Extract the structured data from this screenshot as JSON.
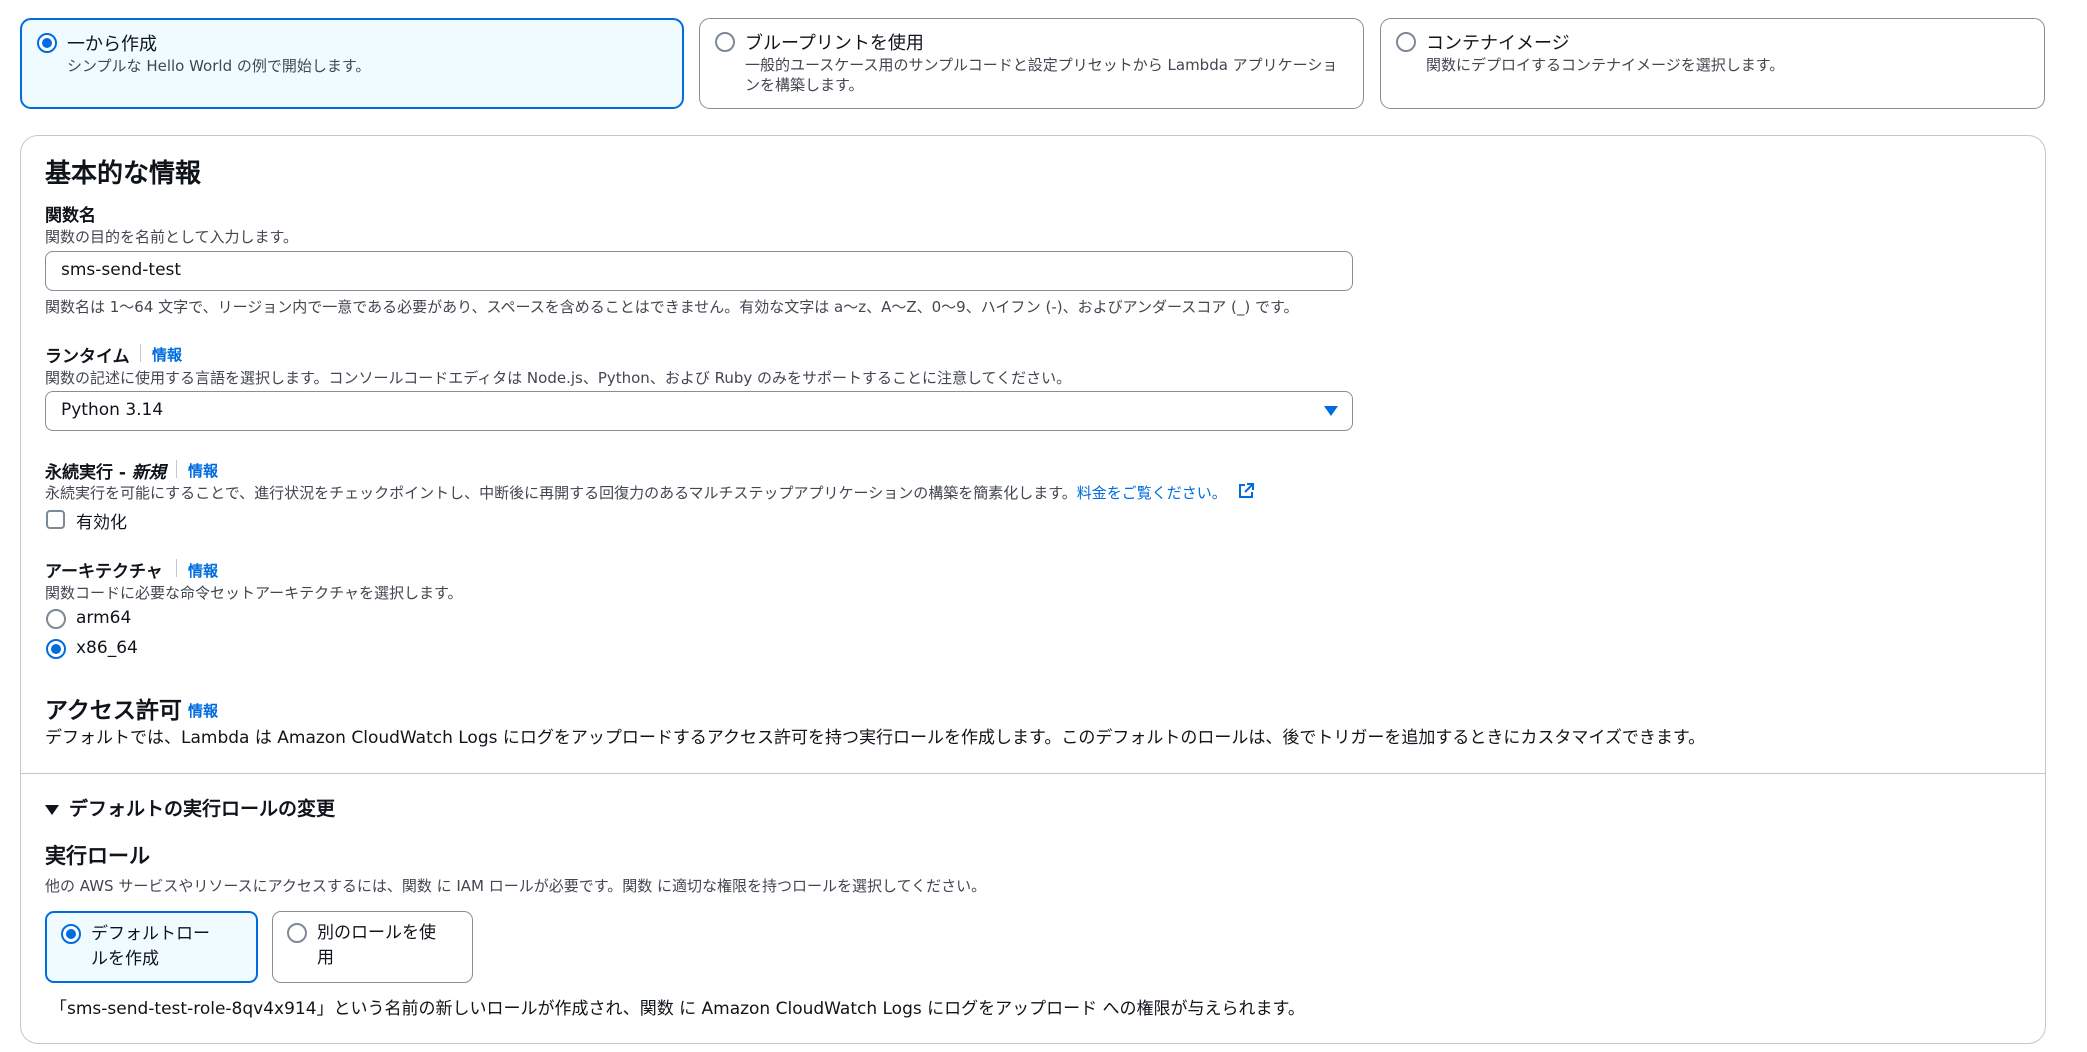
{
  "options": [
    {
      "title": "一から作成",
      "desc": "シンプルな Hello World の例で開始します。",
      "selected": true
    },
    {
      "title": "ブループリントを使用",
      "desc": "一般的ユースケース用のサンプルコードと設定プリセットから Lambda アプリケーションを構築します。",
      "selected": false
    },
    {
      "title": "コンテナイメージ",
      "desc": "関数にデプロイするコンテナイメージを選択します。",
      "selected": false
    }
  ],
  "basic": {
    "heading": "基本的な情報",
    "function_name": {
      "label": "関数名",
      "desc": "関数の目的を名前として入力します。",
      "value": "sms-send-test",
      "constraint": "関数名は 1〜64 文字で、リージョン内で一意である必要があり、スペースを含めることはできません。有効な文字は a〜z、A〜Z、0〜9、ハイフン (-)、およびアンダースコア (_) です。"
    },
    "runtime": {
      "label": "ランタイム",
      "info": "情報",
      "desc": "関数の記述に使用する言語を選択します。コンソールコードエディタは Node.js、Python、および Ruby のみをサポートすることに注意してください。",
      "value": "Python 3.14"
    },
    "durable": {
      "label": "永続実行 - ",
      "label_new": "新規",
      "info": "情報",
      "desc": "永続実行を可能にすることで、進行状況をチェックポイントし、中断後に再開する回復力のあるマルチステップアプリケーションの構築を簡素化します。",
      "link": "料金をご覧ください。",
      "checkbox_label": "有効化",
      "checked": false
    },
    "arch": {
      "label": "アーキテクチャ",
      "info": "情報",
      "desc": "関数コードに必要な命令セットアーキテクチャを選択します。",
      "options": [
        "arm64",
        "x86_64"
      ],
      "selected": "x86_64"
    },
    "access": {
      "heading": "アクセス許可",
      "info": "情報",
      "desc": "デフォルトでは、Lambda は Amazon CloudWatch Logs にログをアップロードするアクセス許可を持つ実行ロールを作成します。このデフォルトのロールは、後でトリガーを追加するときにカスタマイズできます。"
    },
    "role_section": {
      "toggle": "デフォルトの実行ロールの変更",
      "heading": "実行ロール",
      "desc": "他の AWS サービスやリソースにアクセスするには、関数 に IAM ロールが必要です。関数 に適切な権限を持つロールを選択してください。",
      "options": [
        "デフォルトロールを作成",
        "別のロールを使用"
      ],
      "selected": "デフォルトロールを作成",
      "note": "「sms-send-test-role-8qv4x914」という名前の新しいロールが作成され、関数 に Amazon CloudWatch Logs にログをアップロード への権限が与えられます。"
    }
  },
  "colors": {
    "accent": "#006ce0",
    "text": "#0f141a",
    "muted": "#424650",
    "border": "#8c8c94"
  }
}
